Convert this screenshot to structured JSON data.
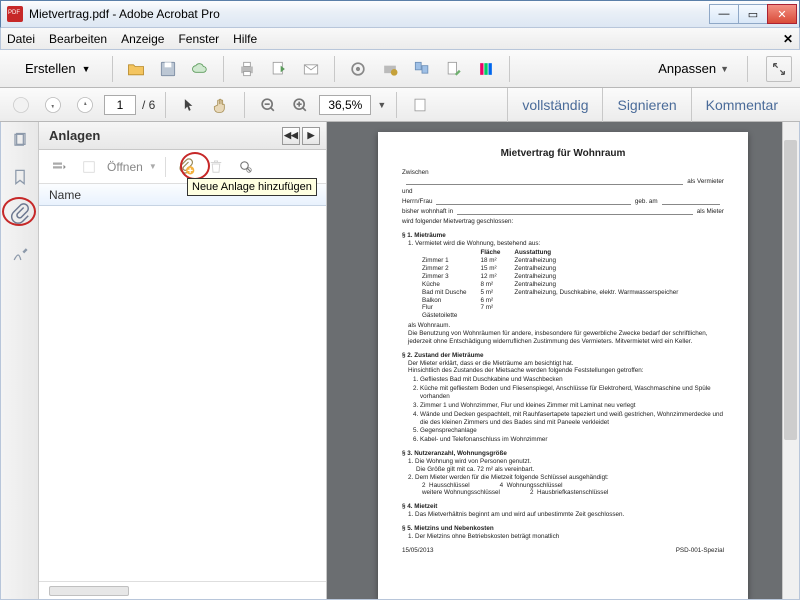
{
  "window": {
    "title": "Mietvertrag.pdf - Adobe Acrobat Pro"
  },
  "menu": {
    "items": [
      "Datei",
      "Bearbeiten",
      "Anzeige",
      "Fenster",
      "Hilfe"
    ]
  },
  "toolbar": {
    "create": "Erstellen",
    "anpassen": "Anpassen"
  },
  "nav": {
    "page": "1",
    "pages": "/ 6",
    "zoom": "36,5%"
  },
  "rightlinks": {
    "a": "vollständig",
    "b": "Signieren",
    "c": "Kommentar"
  },
  "panel": {
    "title": "Anlagen",
    "open": "Öffnen",
    "col": "Name",
    "tooltip": "Neue Anlage hinzufügen"
  },
  "doc": {
    "title": "Mietvertrag für Wohnraum",
    "zwischen": "Zwischen",
    "vermieter": "als Vermieter",
    "und": "und",
    "herr": "Herrn/Frau",
    "geb": "geb. am",
    "wohnhaft": "bisher wohnhaft in",
    "mieter": "als Mieter",
    "abschl": "wird folgender Mietvertrag geschlossen:",
    "s1": "§ 1.  Mieträume",
    "s1_1": "Vermietet wird die Wohnung, bestehend aus:",
    "th_room": "",
    "th_flaeche": "Fläche",
    "th_ausst": "Ausstattung",
    "rooms": [
      [
        "Zimmer 1",
        "18 m²",
        "Zentralheizung"
      ],
      [
        "Zimmer 2",
        "15 m²",
        "Zentralheizung"
      ],
      [
        "Zimmer 3",
        "12 m²",
        "Zentralheizung"
      ],
      [
        "Küche",
        "8 m²",
        "Zentralheizung"
      ],
      [
        "Bad mit Dusche",
        "5 m²",
        "Zentralheizung, Duschkabine, elektr. Warmwasserspeicher"
      ],
      [
        "Balkon",
        "6 m²",
        ""
      ],
      [
        "Flur",
        "7 m²",
        ""
      ],
      [
        "Gästetoilette",
        "",
        ""
      ]
    ],
    "wohnraum": "als Wohnraum.",
    "s1_note": "Die Benutzung von Wohnräumen für andere, insbesondere für gewerbliche Zwecke bedarf der schriftlichen, jederzeit ohne Entschädigung widerruflichen Zustimmung des Vermieters. Mitvermietet wird ein Keller.",
    "s2": "§ 2.  Zustand der Mieträume",
    "s2_a": "Der Mieter erklärt, dass er die Mieträume am             besichtigt hat.",
    "s2_b": "Hinsichtlich des Zustandes der Mietsache werden folgende Feststellungen getroffen:",
    "s2_list": [
      "Gefliestes Bad mit Duschkabine und Waschbecken",
      "Küche mit gefliestem Boden und Fliesenspiegel, Anschlüsse für Elektroherd, Waschmaschine und Spüle vorhanden",
      "Zimmer 1 und Wohnzimmer, Flur und kleines Zimmer mit Laminat neu verlegt",
      "Wände und Decken gespachtelt, mit Rauhfasertapete tapeziert und weiß gestrichen, Wohnzimmerdecke und die des kleinen Zimmers und des Bades sind mit Paneele verkleidet",
      "Gegensprechanlage",
      "Kabel- und Telefonanschluss im Wohnzimmer"
    ],
    "s3": "§ 3.  Nutzeranzahl, Wohnungsgröße",
    "s3_1": "Die Wohnung wird von          Personen genutzt.",
    "s3_2": "Die Größe gilt mit ca. 72 m² als vereinbart.",
    "s3_3": "Dem Mieter werden für die Mietzeit folgende Schlüssel ausgehändigt:",
    "keys": [
      [
        "2",
        "Hausschlüssel"
      ],
      [
        "4",
        "Wohnungsschlüssel"
      ],
      [
        "",
        "weitere Wohnungsschlüssel"
      ],
      [
        "2",
        "Hausbriefkastenschlüssel"
      ]
    ],
    "s4": "§ 4.  Mietzeit",
    "s4_1": "Das Mietverhältnis beginnt am                              und wird auf unbestimmte Zeit geschlossen.",
    "s5": "§ 5.  Mietzins und Nebenkosten",
    "s5_1": "Der Mietzins ohne Betriebskosten beträgt monatlich",
    "foot_date": "15/05/2013",
    "foot_id": "PSD-001-Spezial"
  }
}
